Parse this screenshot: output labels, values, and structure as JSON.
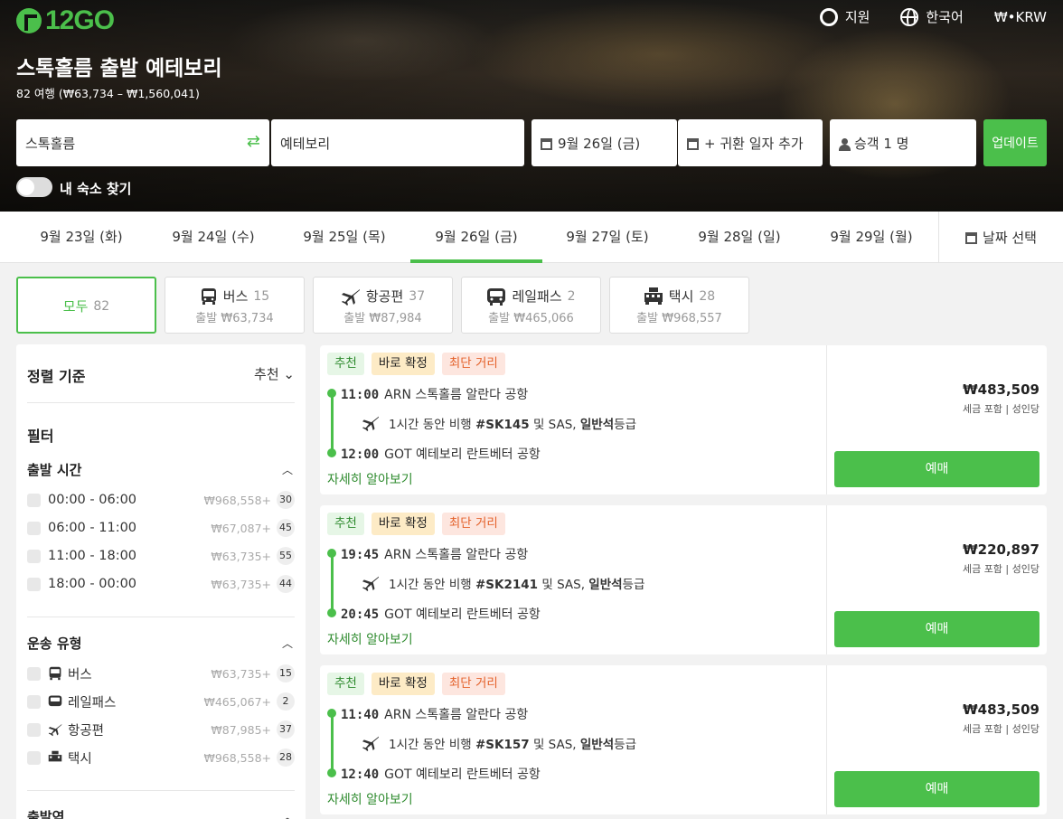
{
  "brand": {
    "logo": "12GO",
    "color": "#4bbf4b"
  },
  "topnav": {
    "support": {
      "label": "지원",
      "icon": "lifebuoy-icon"
    },
    "language": {
      "label": "한국어",
      "icon": "globe-icon"
    },
    "currency": {
      "label": "₩•KRW"
    }
  },
  "route": {
    "title": "스톡홀름 출발 예테보리",
    "subtitle": "82 여행 (₩63,734 – ₩1,560,041)"
  },
  "search": {
    "from": "스톡홀름",
    "to": "예테보리",
    "date": "9월 26일 (금)",
    "return": "+ 귀환 일자 추가",
    "passengers": "승객 1 명",
    "update_label": "업데이트",
    "toggle_label": "내 숙소 찾기"
  },
  "dates": [
    {
      "label": "9월 23일 (화)",
      "active": false
    },
    {
      "label": "9월 24일 (수)",
      "active": false
    },
    {
      "label": "9월 25일 (목)",
      "active": false
    },
    {
      "label": "9월 26일 (금)",
      "active": true
    },
    {
      "label": "9월 27일 (토)",
      "active": false
    },
    {
      "label": "9월 28일 (일)",
      "active": false
    },
    {
      "label": "9월 29일 (월)",
      "active": false
    }
  ],
  "date_picker_label": "날짜 선택",
  "modes": [
    {
      "label": "모두",
      "count": "82",
      "from": "",
      "icon": ""
    },
    {
      "label": "버스",
      "count": "15",
      "from": "출발 ₩63,734",
      "icon": "bus-icon"
    },
    {
      "label": "항공편",
      "count": "37",
      "from": "출발 ₩87,984",
      "icon": "plane-icon"
    },
    {
      "label": "레일패스",
      "count": "2",
      "from": "출발 ₩465,066",
      "icon": "train-icon"
    },
    {
      "label": "택시",
      "count": "28",
      "from": "출발 ₩968,557",
      "icon": "taxi-icon"
    }
  ],
  "sidebar": {
    "sort_heading": "정렬 기준",
    "sort_value": "추천",
    "filter_heading": "필터",
    "departure_time": {
      "heading": "출발 시간",
      "items": [
        {
          "label": "00:00 - 06:00",
          "price": "₩968,558+",
          "count": "30"
        },
        {
          "label": "06:00 - 11:00",
          "price": "₩67,087+",
          "count": "45"
        },
        {
          "label": "11:00 - 18:00",
          "price": "₩63,735+",
          "count": "55"
        },
        {
          "label": "18:00 - 00:00",
          "price": "₩63,735+",
          "count": "44"
        }
      ]
    },
    "transport_type": {
      "heading": "운송 유형",
      "items": [
        {
          "label": "버스",
          "price": "₩63,735+",
          "count": "15",
          "icon": "bus-icon"
        },
        {
          "label": "레일패스",
          "price": "₩465,067+",
          "count": "2",
          "icon": "train-icon"
        },
        {
          "label": "항공편",
          "price": "₩87,985+",
          "count": "37",
          "icon": "plane-icon"
        },
        {
          "label": "택시",
          "price": "₩968,558+",
          "count": "28",
          "icon": "taxi-icon"
        }
      ]
    },
    "station_heading": "출발역"
  },
  "results": [
    {
      "tags": [
        "추천",
        "바로 확정",
        "최단 거리"
      ],
      "dep_time": "11:00",
      "dep_place": "ARN 스톡홀름 알란다 공항",
      "flight_pre": "1시간 동안 비행 ",
      "flight_no": "#SK145",
      "flight_mid": " 및 SAS, ",
      "flight_class": "일반석",
      "flight_post": "등급",
      "arr_time": "12:00",
      "arr_place": "GOT 예테보리 란트베터 공항",
      "more": "자세히 알아보기",
      "price": "₩483,509",
      "price_note": "세금 포함 | 성인당",
      "buy": "예매"
    },
    {
      "tags": [
        "추천",
        "바로 확정",
        "최단 거리"
      ],
      "dep_time": "19:45",
      "dep_place": "ARN 스톡홀름 알란다 공항",
      "flight_pre": "1시간 동안 비행 ",
      "flight_no": "#SK2141",
      "flight_mid": " 및 SAS, ",
      "flight_class": "일반석",
      "flight_post": "등급",
      "arr_time": "20:45",
      "arr_place": "GOT 예테보리 란트베터 공항",
      "more": "자세히 알아보기",
      "price": "₩220,897",
      "price_note": "세금 포함 | 성인당",
      "buy": "예매"
    },
    {
      "tags": [
        "추천",
        "바로 확정",
        "최단 거리"
      ],
      "dep_time": "11:40",
      "dep_place": "ARN 스톡홀름 알란다 공항",
      "flight_pre": "1시간 동안 비행 ",
      "flight_no": "#SK157",
      "flight_mid": " 및 SAS, ",
      "flight_class": "일반석",
      "flight_post": "등급",
      "arr_time": "12:40",
      "arr_place": "GOT 예테보리 란트베터 공항",
      "more": "자세히 알아보기",
      "price": "₩483,509",
      "price_note": "세금 포함 | 성인당",
      "buy": "예매"
    }
  ]
}
